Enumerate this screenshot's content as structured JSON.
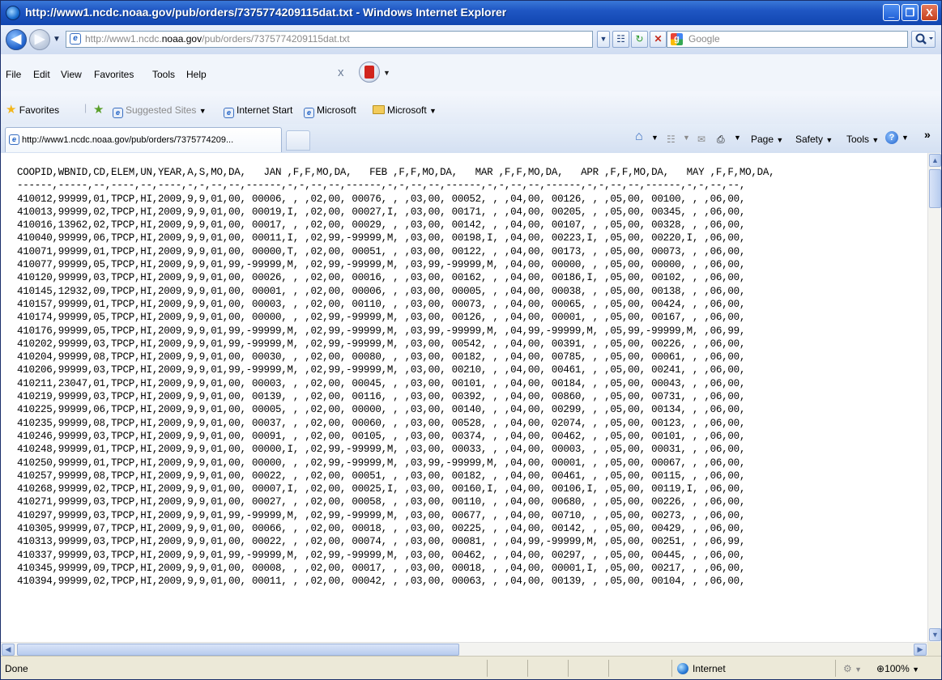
{
  "window": {
    "title": "http://www1.ncdc.noaa.gov/pub/orders/7375774209115dat.txt - Windows Internet Explorer",
    "minimize": "_",
    "maximize": "❐",
    "close": "X"
  },
  "address": {
    "url_prefix": "http://www1.ncdc.",
    "url_domain": "noaa.gov",
    "url_suffix": "/pub/orders/7375774209115dat.txt",
    "search_placeholder": "Google"
  },
  "menu": {
    "file": "File",
    "edit": "Edit",
    "view": "View",
    "favorites": "Favorites",
    "tools": "Tools",
    "help": "Help"
  },
  "favorites_bar": {
    "favorites": "Favorites",
    "suggested_sites": "Suggested Sites",
    "internet_start": "Internet Start",
    "microsoft_link": "Microsoft",
    "microsoft_folder": "Microsoft"
  },
  "tab": {
    "title": "http://www1.ncdc.noaa.gov/pub/orders/7375774209..."
  },
  "command_bar": {
    "page": "Page",
    "safety": "Safety",
    "tools": "Tools"
  },
  "document": {
    "lines": [
      "COOPID,WBNID,CD,ELEM,UN,YEAR,A,S,MO,DA,   JAN ,F,F,MO,DA,   FEB ,F,F,MO,DA,   MAR ,F,F,MO,DA,   APR ,F,F,MO,DA,   MAY ,F,F,MO,DA,",
      "------,-----,--,----,--,----,-,-,--,--,------,-,-,--,--,------,-,-,--,--,------,-,-,--,--,------,-,-,--,--,------,-,-,--,--,",
      "410012,99999,01,TPCP,HI,2009,9,9,01,00, 00006, , ,02,00, 00076, , ,03,00, 00052, , ,04,00, 00126, , ,05,00, 00100, , ,06,00,",
      "410013,99999,02,TPCP,HI,2009,9,9,01,00, 00019,I, ,02,00, 00027,I, ,03,00, 00171, , ,04,00, 00205, , ,05,00, 00345, , ,06,00,",
      "410016,13962,02,TPCP,HI,2009,9,9,01,00, 00017, , ,02,00, 00029, , ,03,00, 00142, , ,04,00, 00107, , ,05,00, 00328, , ,06,00,",
      "410040,99999,06,TPCP,HI,2009,9,9,01,00, 00011,I, ,02,99,-99999,M, ,03,00, 00198,I, ,04,00, 00223,I, ,05,00, 00220,I, ,06,00,",
      "410071,99999,01,TPCP,HI,2009,9,9,01,00, 00000,T, ,02,00, 00051, , ,03,00, 00122, , ,04,00, 00173, , ,05,00, 00073, , ,06,00,",
      "410077,99999,05,TPCP,HI,2009,9,9,01,99,-99999,M, ,02,99,-99999,M, ,03,99,-99999,M, ,04,00, 00000, , ,05,00, 00000, , ,06,00,",
      "410120,99999,03,TPCP,HI,2009,9,9,01,00, 00026, , ,02,00, 00016, , ,03,00, 00162, , ,04,00, 00186,I, ,05,00, 00102, , ,06,00,",
      "410145,12932,09,TPCP,HI,2009,9,9,01,00, 00001, , ,02,00, 00006, , ,03,00, 00005, , ,04,00, 00038, , ,05,00, 00138, , ,06,00,",
      "410157,99999,01,TPCP,HI,2009,9,9,01,00, 00003, , ,02,00, 00110, , ,03,00, 00073, , ,04,00, 00065, , ,05,00, 00424, , ,06,00,",
      "410174,99999,05,TPCP,HI,2009,9,9,01,00, 00000, , ,02,99,-99999,M, ,03,00, 00126, , ,04,00, 00001, , ,05,00, 00167, , ,06,00,",
      "410176,99999,05,TPCP,HI,2009,9,9,01,99,-99999,M, ,02,99,-99999,M, ,03,99,-99999,M, ,04,99,-99999,M, ,05,99,-99999,M, ,06,99,",
      "410202,99999,03,TPCP,HI,2009,9,9,01,99,-99999,M, ,02,99,-99999,M, ,03,00, 00542, , ,04,00, 00391, , ,05,00, 00226, , ,06,00,",
      "410204,99999,08,TPCP,HI,2009,9,9,01,00, 00030, , ,02,00, 00080, , ,03,00, 00182, , ,04,00, 00785, , ,05,00, 00061, , ,06,00,",
      "410206,99999,03,TPCP,HI,2009,9,9,01,99,-99999,M, ,02,99,-99999,M, ,03,00, 00210, , ,04,00, 00461, , ,05,00, 00241, , ,06,00,",
      "410211,23047,01,TPCP,HI,2009,9,9,01,00, 00003, , ,02,00, 00045, , ,03,00, 00101, , ,04,00, 00184, , ,05,00, 00043, , ,06,00,",
      "410219,99999,03,TPCP,HI,2009,9,9,01,00, 00139, , ,02,00, 00116, , ,03,00, 00392, , ,04,00, 00860, , ,05,00, 00731, , ,06,00,",
      "410225,99999,06,TPCP,HI,2009,9,9,01,00, 00005, , ,02,00, 00000, , ,03,00, 00140, , ,04,00, 00299, , ,05,00, 00134, , ,06,00,",
      "410235,99999,08,TPCP,HI,2009,9,9,01,00, 00037, , ,02,00, 00060, , ,03,00, 00528, , ,04,00, 02074, , ,05,00, 00123, , ,06,00,",
      "410246,99999,03,TPCP,HI,2009,9,9,01,00, 00091, , ,02,00, 00105, , ,03,00, 00374, , ,04,00, 00462, , ,05,00, 00101, , ,06,00,",
      "410248,99999,01,TPCP,HI,2009,9,9,01,00, 00000,I, ,02,99,-99999,M, ,03,00, 00033, , ,04,00, 00003, , ,05,00, 00031, , ,06,00,",
      "410250,99999,01,TPCP,HI,2009,9,9,01,00, 00000, , ,02,99,-99999,M, ,03,99,-99999,M, ,04,00, 00001, , ,05,00, 00067, , ,06,00,",
      "410257,99999,08,TPCP,HI,2009,9,9,01,00, 00022, , ,02,00, 00051, , ,03,00, 00182, , ,04,00, 00461, , ,05,00, 00115, , ,06,00,",
      "410268,99999,02,TPCP,HI,2009,9,9,01,00, 00007,I, ,02,00, 00025,I, ,03,00, 00160,I, ,04,00, 00106,I, ,05,00, 00119,I, ,06,00,",
      "410271,99999,03,TPCP,HI,2009,9,9,01,00, 00027, , ,02,00, 00058, , ,03,00, 00110, , ,04,00, 00680, , ,05,00, 00226, , ,06,00,",
      "410297,99999,03,TPCP,HI,2009,9,9,01,99,-99999,M, ,02,99,-99999,M, ,03,00, 00677, , ,04,00, 00710, , ,05,00, 00273, , ,06,00,",
      "410305,99999,07,TPCP,HI,2009,9,9,01,00, 00066, , ,02,00, 00018, , ,03,00, 00225, , ,04,00, 00142, , ,05,00, 00429, , ,06,00,",
      "410313,99999,03,TPCP,HI,2009,9,9,01,00, 00022, , ,02,00, 00074, , ,03,00, 00081, , ,04,99,-99999,M, ,05,00, 00251, , ,06,99,",
      "410337,99999,03,TPCP,HI,2009,9,9,01,99,-99999,M, ,02,99,-99999,M, ,03,00, 00462, , ,04,00, 00297, , ,05,00, 00445, , ,06,00,",
      "410345,99999,09,TPCP,HI,2009,9,9,01,00, 00008, , ,02,00, 00017, , ,03,00, 00018, , ,04,00, 00001,I, ,05,00, 00217, , ,06,00,",
      "410394,99999,02,TPCP,HI,2009,9,9,01,00, 00011, , ,02,00, 00042, , ,03,00, 00063, , ,04,00, 00139, , ,05,00, 00104, , ,06,00,"
    ]
  },
  "status": {
    "text": "Done",
    "zone": "Internet",
    "zoom": "100%"
  },
  "icons": {
    "back": "arrow-left",
    "forward": "arrow-right",
    "page": "ie-page",
    "search": "magnifier"
  }
}
